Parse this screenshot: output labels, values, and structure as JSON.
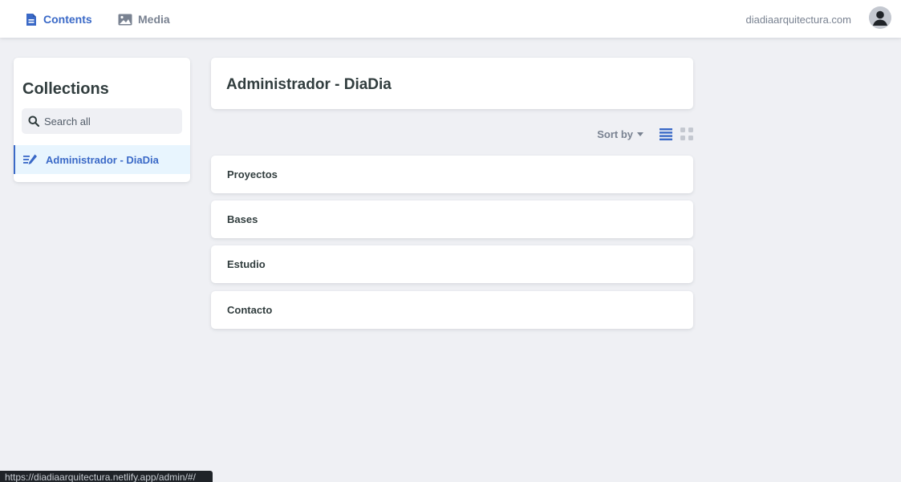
{
  "topbar": {
    "contents_label": "Contents",
    "media_label": "Media",
    "site_link": "diadiaarquitectura.com"
  },
  "sidebar": {
    "title": "Collections",
    "search_placeholder": "Search all",
    "items": [
      {
        "label": "Administrador - DiaDia"
      }
    ]
  },
  "main": {
    "title": "Administrador - DiaDia",
    "sort_label": "Sort by",
    "entries": [
      {
        "label": "Proyectos"
      },
      {
        "label": "Bases"
      },
      {
        "label": "Estudio"
      },
      {
        "label": "Contacto"
      }
    ]
  },
  "status_bar": {
    "url": "https://diadiaarquitectura.netlify.app/admin/#/"
  },
  "colors": {
    "accent": "#3a69c7",
    "background": "#eff0f4",
    "active_item_bg": "#e8f5fe",
    "muted_text": "#798291"
  },
  "icons": {
    "contents": "document-icon",
    "media": "image-icon",
    "collection": "write-icon",
    "search": "search-icon",
    "sort": "caret-down-icon",
    "list_view": "list-view-icon",
    "grid_view": "grid-view-icon",
    "avatar": "user-icon"
  }
}
